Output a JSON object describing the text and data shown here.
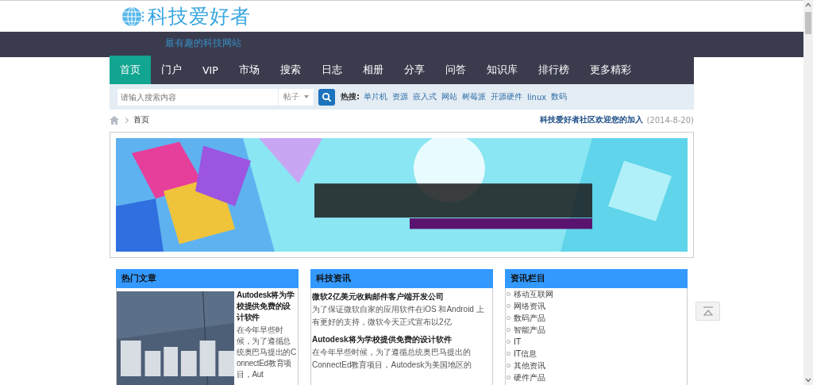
{
  "logo": {
    "text": "科技爱好者"
  },
  "tagline": "最有趣的科技网站",
  "nav": [
    {
      "label": "首页",
      "selected": true
    },
    {
      "label": "门户",
      "selected": false
    },
    {
      "label": "VIP",
      "selected": false
    },
    {
      "label": "市场",
      "selected": false
    },
    {
      "label": "搜索",
      "selected": false
    },
    {
      "label": "日志",
      "selected": false
    },
    {
      "label": "相册",
      "selected": false
    },
    {
      "label": "分享",
      "selected": false
    },
    {
      "label": "问答",
      "selected": false
    },
    {
      "label": "知识库",
      "selected": false
    },
    {
      "label": "排行榜",
      "selected": false
    },
    {
      "label": "更多精彩",
      "selected": false
    }
  ],
  "search": {
    "placeholder": "请输入搜索内容",
    "scope": "帖子",
    "hot_label": "热搜:",
    "hot": [
      "单片机",
      "资源",
      "嵌入式",
      "网站",
      "树莓派",
      "开源硬件",
      "linux",
      "数码"
    ]
  },
  "breadcrumb": {
    "current": "首页"
  },
  "welcome": {
    "text": "科技爱好者社区欢迎您的加入",
    "date": "(2014-8-20)"
  },
  "hot_articles": {
    "title": "热门文章",
    "article": {
      "title": "Autodesk将为学校提供免费的设计软件",
      "summary": "在今年早些时候，为了遵循总统奥巴马提出的ConnectEd教育项目，Aut"
    }
  },
  "news": {
    "title": "科技资讯",
    "items": [
      {
        "title": "微软2亿美元收购邮件客户端开发公司",
        "summary": "为了保证微软自家的应用软件在iOS 和Android 上有更好的支持，微软今天正式宣布以2亿"
      },
      {
        "title": "Autodesk将为学校提供免费的设计软件",
        "summary": "在今年早些时候，为了遵循总统奥巴马提出的ConnectEd教育项目，Autodesk为美国地区的"
      }
    ]
  },
  "categories": {
    "title": "资讯栏目",
    "items": [
      "移动互联网",
      "网络资讯",
      "数码产品",
      "智能产品",
      "IT",
      "IT信息",
      "其他资讯",
      "硬件产品"
    ]
  }
}
